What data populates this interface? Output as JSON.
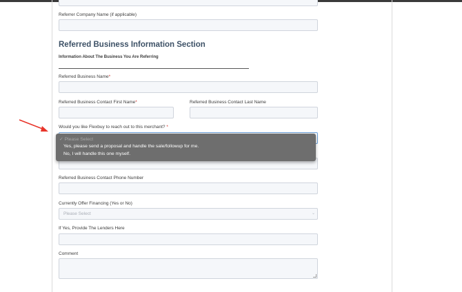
{
  "form": {
    "referrer_company_label": "Referrer Company Name (if applicable)",
    "section_title": "Referred Business Information Section",
    "section_subtitle": "Information About The Business You Are Referring",
    "business_name_label": "Referred Business Name",
    "contact_first_label": "Referred Business Contact First Name",
    "contact_last_label": "Referred Business Contact Last Name",
    "reach_out_label": "Would you like Flexbuy to reach out to this merchant?",
    "required_marker": "*",
    "phone_label": "Referred Business Contact Phone Number",
    "financing_label": "Currently Offer Financing (Yes or No)",
    "financing_placeholder": "Please Select",
    "lenders_label": "If Yes, Provide The Lenders Here",
    "comment_label": "Comment"
  },
  "dropdown": {
    "placeholder_option": "✓ Please Select",
    "options": [
      "Yes, please send a proposal and handle the sale/followup for me.",
      "No, I will handle this one myself."
    ]
  },
  "annotation": {
    "arrow_color": "#e8342a"
  },
  "icons": {
    "select_chevron": "chevron-updown-icon",
    "arrow": "red-arrow-icon"
  }
}
